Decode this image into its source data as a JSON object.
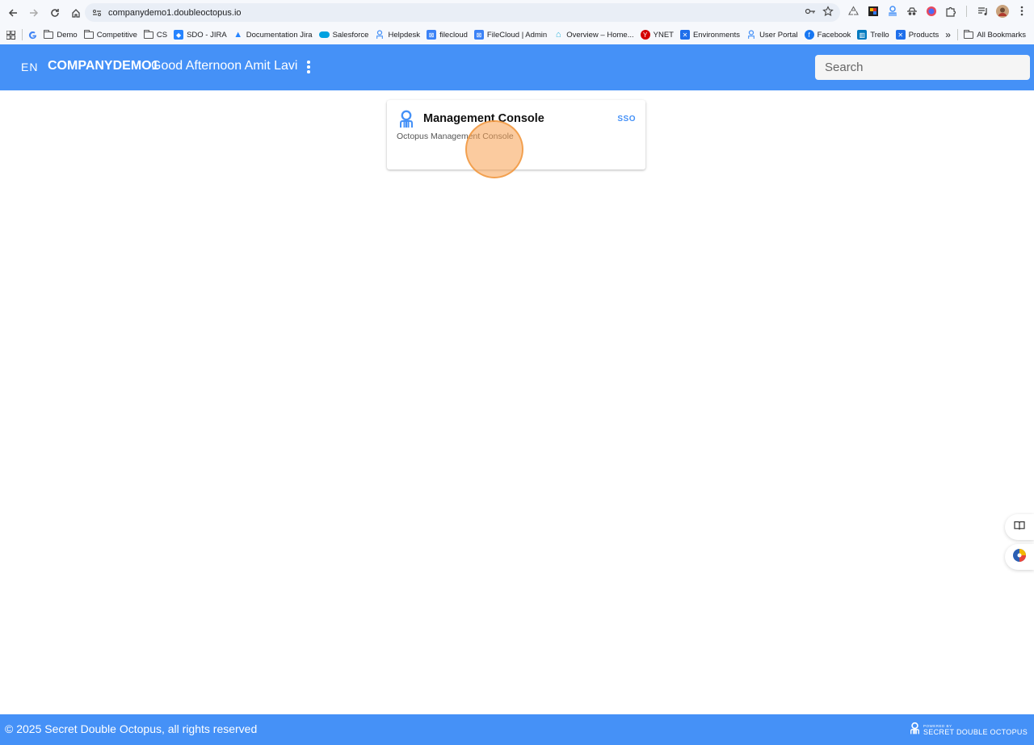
{
  "browser": {
    "url": "companydemo1.doubleoctopus.io",
    "bookmarks": [
      {
        "label": "Demo",
        "icon": "folder-icon"
      },
      {
        "label": "Competitive",
        "icon": "folder-icon"
      },
      {
        "label": "CS",
        "icon": "folder-icon"
      },
      {
        "label": "SDO - JIRA",
        "icon": "jira-icon"
      },
      {
        "label": "Documentation Jira",
        "icon": "atlassian-icon"
      },
      {
        "label": "Salesforce",
        "icon": "salesforce-icon"
      },
      {
        "label": "Helpdesk",
        "icon": "octopus-icon"
      },
      {
        "label": "filecloud",
        "icon": "filecloud-icon"
      },
      {
        "label": "FileCloud | Admin",
        "icon": "filecloud-icon"
      },
      {
        "label": "Overview – Home...",
        "icon": "overview-icon"
      },
      {
        "label": "YNET",
        "icon": "ynet-icon"
      },
      {
        "label": "Environments",
        "icon": "x-icon"
      },
      {
        "label": "User Portal",
        "icon": "octopus-icon"
      },
      {
        "label": "Facebook",
        "icon": "facebook-icon"
      },
      {
        "label": "Trello",
        "icon": "trello-icon"
      },
      {
        "label": "Products",
        "icon": "x-icon"
      }
    ],
    "all_bookmarks": "All Bookmarks",
    "more": "»"
  },
  "header": {
    "lang": "EN",
    "company": "COMPANYDEMO1",
    "greeting": "Good Afternoon Amit Lavi",
    "search_placeholder": "Search"
  },
  "apps": [
    {
      "title": "Management Console",
      "badge": "SSO",
      "description": "Octopus Management Console"
    }
  ],
  "footer": {
    "copyright": "© 2025 Secret Double Octopus, all rights reserved",
    "powered_by": "POWERED BY",
    "brand": "SECRET DOUBLE OCTOPUS"
  },
  "colors": {
    "accent": "#4591f7"
  }
}
